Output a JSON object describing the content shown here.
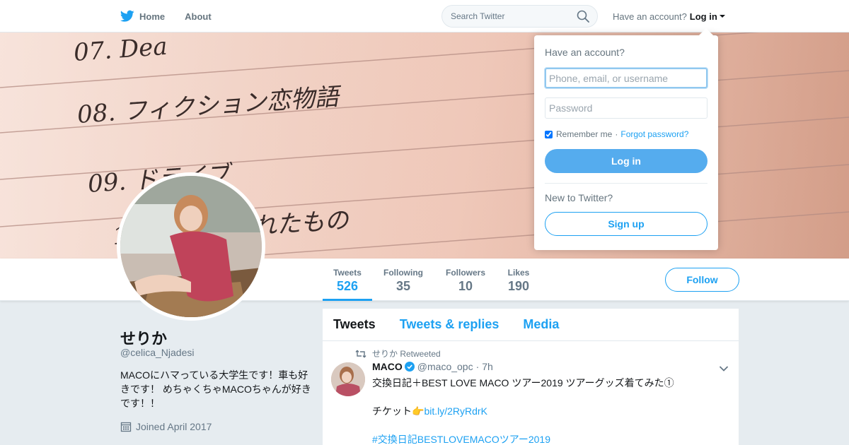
{
  "nav": {
    "home_label": "Home",
    "about_label": "About",
    "search_placeholder": "Search Twitter",
    "have_account": "Have an account?",
    "login_label": "Log in"
  },
  "header_image": {
    "handwriting": [
      "07. Dea",
      "08. フィクション恋物語",
      "09. ドライブ",
      "10. 教えてくれたもの"
    ]
  },
  "stats": [
    {
      "label": "Tweets",
      "value": "526",
      "active": true
    },
    {
      "label": "Following",
      "value": "35",
      "active": false
    },
    {
      "label": "Followers",
      "value": "10",
      "active": false
    },
    {
      "label": "Likes",
      "value": "190",
      "active": false
    }
  ],
  "follow_label": "Follow",
  "profile": {
    "name": "せりか",
    "handle": "@celica_Njadesi",
    "bio": "MACOにハマっている大学生です！車も好きです！ めちゃくちゃMACOちゃんが好きです！！",
    "joined": "Joined April 2017"
  },
  "timeline": {
    "tabs": [
      "Tweets",
      "Tweets & replies",
      "Media"
    ]
  },
  "tweet": {
    "retweeted_by": "せりか Retweeted",
    "author_name": "MACO",
    "author_handle": "@maco_opc",
    "dot": "·",
    "time": "7h",
    "line1": "交換日記＋BEST LOVE MACO ツアー2019 ツアーグッズ着てみた①",
    "line2_text": "チケット",
    "line2_emoji": "👉",
    "line2_link": "bit.ly/2RyRdrK",
    "line3_hashtag": "#交換日記BESTLOVEMACOツアー2019"
  },
  "login_dropdown": {
    "title": "Have an account?",
    "username_placeholder": "Phone, email, or username",
    "password_placeholder": "Password",
    "remember_label": "Remember me",
    "separator": "·",
    "forgot_label": "Forgot password?",
    "login_button": "Log in",
    "new_to_twitter": "New to Twitter?",
    "signup_button": "Sign up"
  },
  "colors": {
    "accent": "#1da1f2",
    "background": "#e6ecf0",
    "text_primary": "#14171a",
    "text_secondary": "#657786"
  }
}
